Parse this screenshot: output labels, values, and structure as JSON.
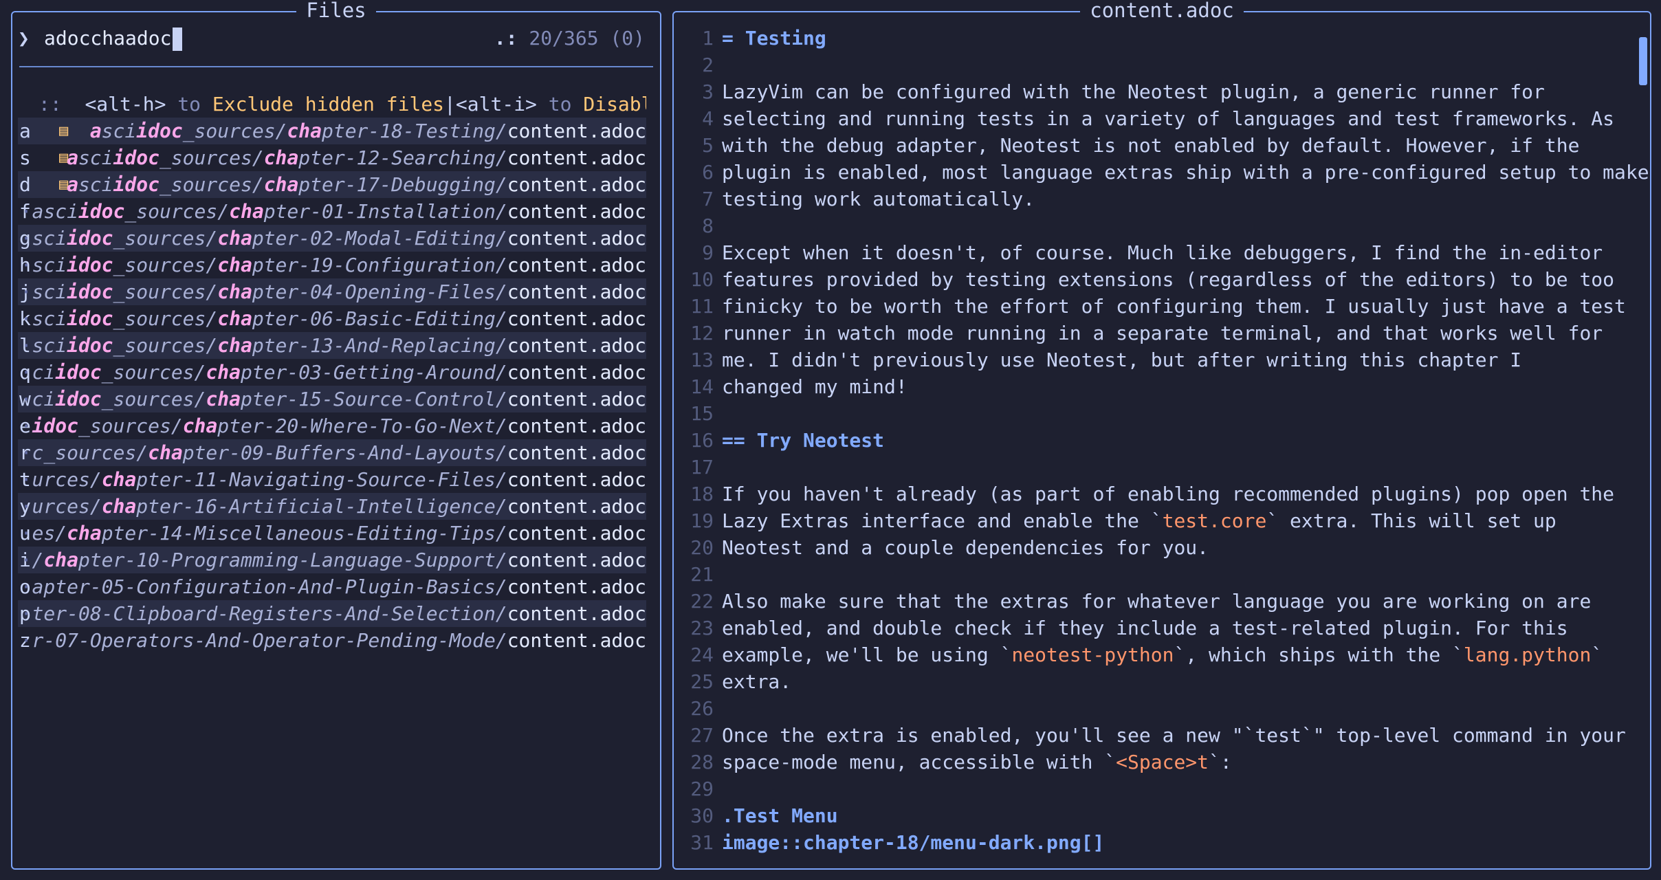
{
  "files_panel": {
    "title": "Files",
    "prompt": {
      "chevron": "❯",
      "query": "adocchaadoc",
      "count_prefix": ".:",
      "count": "20/365 (0)"
    },
    "hint": {
      "sep": "::",
      "key1": "<alt-h>",
      "to1": "to",
      "desc1": "Exclude hidden files",
      "bar": "|",
      "key2": "<alt-i>",
      "to2": "to",
      "desc2": "Disable··"
    },
    "rows": [
      {
        "key": "a",
        "trail": "",
        "icon": "▤",
        "hl": "a",
        "dir_pre": "sci",
        "hl2": "idoc",
        "dir_mid": "_sources/",
        "hl3": "cha",
        "dir_post": "pter-18-Testing/",
        "file": "content.adoc"
      },
      {
        "key": "s",
        "trail": "",
        "icon": "▤",
        "hl": "a",
        "dir_pre": "sci",
        "hl2": "idoc",
        "dir_mid": "_sources/",
        "hl3": "cha",
        "dir_post": "pter-12-Searching/",
        "file": "content.adoc"
      },
      {
        "key": "d",
        "trail": "",
        "icon": "▤",
        "hl": "a",
        "dir_pre": "sci",
        "hl2": "idoc",
        "dir_mid": "_sources/",
        "hl3": "cha",
        "dir_post": "pter-17-Debugging/",
        "file": "content.adoc"
      },
      {
        "key": "f",
        "trail": "··",
        "icon": "",
        "hl": "",
        "dir_pre": "asci",
        "hl2": "idoc",
        "dir_mid": "_sources/",
        "hl3": "cha",
        "dir_post": "pter-01-Installation/",
        "file": "content.adoc"
      },
      {
        "key": "g",
        "trail": "··",
        "icon": "",
        "hl": "",
        "dir_pre": "sci",
        "hl2": "idoc",
        "dir_mid": "_sources/",
        "hl3": "cha",
        "dir_post": "pter-02-Modal-Editing/",
        "file": "content.adoc"
      },
      {
        "key": "h",
        "trail": "··",
        "icon": "",
        "hl": "",
        "dir_pre": "sci",
        "hl2": "idoc",
        "dir_mid": "_sources/",
        "hl3": "cha",
        "dir_post": "pter-19-Configuration/",
        "file": "content.adoc"
      },
      {
        "key": "j",
        "trail": "··",
        "icon": "",
        "hl": "",
        "dir_pre": "sci",
        "hl2": "idoc",
        "dir_mid": "_sources/",
        "hl3": "cha",
        "dir_post": "pter-04-Opening-Files/",
        "file": "content.adoc"
      },
      {
        "key": "k",
        "trail": "··",
        "icon": "",
        "hl": "",
        "dir_pre": "sci",
        "hl2": "idoc",
        "dir_mid": "_sources/",
        "hl3": "cha",
        "dir_post": "pter-06-Basic-Editing/",
        "file": "content.adoc"
      },
      {
        "key": "l",
        "trail": "··",
        "icon": "",
        "hl": "",
        "dir_pre": "sci",
        "hl2": "idoc",
        "dir_mid": "_sources/",
        "hl3": "cha",
        "dir_post": "pter-13-And-Replacing/",
        "file": "content.adoc"
      },
      {
        "key": "q",
        "trail": "··",
        "icon": "",
        "hl": "",
        "dir_pre": "ci",
        "hl2": "idoc",
        "dir_mid": "_sources/",
        "hl3": "cha",
        "dir_post": "pter-03-Getting-Around/",
        "file": "content.adoc"
      },
      {
        "key": "w",
        "trail": "··",
        "icon": "",
        "hl": "",
        "dir_pre": "ci",
        "hl2": "idoc",
        "dir_mid": "_sources/",
        "hl3": "cha",
        "dir_post": "pter-15-Source-Control/",
        "file": "content.adoc"
      },
      {
        "key": "e",
        "trail": "··",
        "icon": "",
        "hl": "",
        "dir_pre": "",
        "hl2": "idoc",
        "dir_mid": "_sources/",
        "hl3": "cha",
        "dir_post": "pter-20-Where-To-Go-Next/",
        "file": "content.adoc"
      },
      {
        "key": "r",
        "trail": "··",
        "icon": "",
        "hl": "",
        "dir_pre": "c",
        "hl2": "",
        "dir_mid": "_sources/",
        "hl3": "cha",
        "dir_post": "pter-09-Buffers-And-Layouts/",
        "file": "content.adoc"
      },
      {
        "key": "t",
        "trail": "··",
        "icon": "",
        "hl": "",
        "dir_pre": "urces/",
        "hl2": "",
        "dir_mid": "",
        "hl3": "cha",
        "dir_post": "pter-11-Navigating-Source-Files/",
        "file": "content.adoc"
      },
      {
        "key": "y",
        "trail": "··",
        "icon": "",
        "hl": "",
        "dir_pre": "urces/",
        "hl2": "",
        "dir_mid": "",
        "hl3": "cha",
        "dir_post": "pter-16-Artificial-Intelligence/",
        "file": "content.adoc"
      },
      {
        "key": "u",
        "trail": "··",
        "icon": "",
        "hl": "",
        "dir_pre": "es/",
        "hl2": "",
        "dir_mid": "",
        "hl3": "cha",
        "dir_post": "pter-14-Miscellaneous-Editing-Tips/",
        "file": "content.adoc"
      },
      {
        "key": "i",
        "trail": "··",
        "icon": "",
        "hl": "",
        "dir_pre": "/",
        "hl2": "",
        "dir_mid": "",
        "hl3": "cha",
        "dir_post": "pter-10-Programming-Language-Support/",
        "file": "content.adoc"
      },
      {
        "key": "o",
        "trail": "··",
        "icon": "",
        "hl": "",
        "dir_pre": "apter-05-Configuration-And-Plugin-Basics/",
        "hl2": "",
        "dir_mid": "",
        "hl3": "",
        "dir_post": "",
        "file": "content.adoc"
      },
      {
        "key": "p",
        "trail": "··",
        "icon": "",
        "hl": "",
        "dir_pre": "ter-08-Clipboard-Registers-And-Selection/",
        "hl2": "",
        "dir_mid": "",
        "hl3": "",
        "dir_post": "",
        "file": "content.adoc"
      },
      {
        "key": "z",
        "trail": "··",
        "icon": "",
        "hl": "",
        "dir_pre": "r-07-Operators-And-Operator-Pending-Mode/",
        "hl2": "",
        "dir_mid": "",
        "hl3": "",
        "dir_post": "",
        "file": "content.adoc"
      }
    ]
  },
  "preview_panel": {
    "title": "content.adoc",
    "lines": [
      {
        "n": "1",
        "parts": [
          {
            "t": "= Testing",
            "c": "h1"
          }
        ]
      },
      {
        "n": "2",
        "parts": []
      },
      {
        "n": "3",
        "parts": [
          {
            "t": "LazyVim can be configured with the Neotest plugin, a generic runner for",
            "c": ""
          }
        ]
      },
      {
        "n": "4",
        "parts": [
          {
            "t": "selecting and running tests in a variety of languages and test frameworks. As",
            "c": ""
          }
        ]
      },
      {
        "n": "5",
        "parts": [
          {
            "t": "with the debug adapter, Neotest is not enabled by default. However, if the",
            "c": ""
          }
        ]
      },
      {
        "n": "6",
        "parts": [
          {
            "t": "plugin is enabled, most language extras ship with a pre-configured setup to make",
            "c": ""
          }
        ]
      },
      {
        "n": "7",
        "parts": [
          {
            "t": "testing work automatically.",
            "c": ""
          }
        ]
      },
      {
        "n": "8",
        "parts": []
      },
      {
        "n": "9",
        "parts": [
          {
            "t": "Except when it doesn't, of course. Much like debuggers, I find the in-editor",
            "c": ""
          }
        ]
      },
      {
        "n": "10",
        "parts": [
          {
            "t": "features provided by testing extensions (regardless of the editors) to be too",
            "c": ""
          }
        ]
      },
      {
        "n": "11",
        "parts": [
          {
            "t": "finicky to be worth the effort of configuring them. I usually just have a test",
            "c": ""
          }
        ]
      },
      {
        "n": "12",
        "parts": [
          {
            "t": "runner in watch mode running in a separate terminal, and that works well for",
            "c": ""
          }
        ]
      },
      {
        "n": "13",
        "parts": [
          {
            "t": "me. I didn't previously use Neotest, but after writing this chapter I",
            "c": ""
          }
        ]
      },
      {
        "n": "14",
        "parts": [
          {
            "t": "changed my mind!",
            "c": ""
          }
        ]
      },
      {
        "n": "15",
        "parts": []
      },
      {
        "n": "16",
        "parts": [
          {
            "t": "== Try Neotest",
            "c": "h1"
          }
        ]
      },
      {
        "n": "17",
        "parts": []
      },
      {
        "n": "18",
        "parts": [
          {
            "t": "If you haven't already (as part of enabling recommended plugins) pop open the",
            "c": ""
          }
        ]
      },
      {
        "n": "19",
        "parts": [
          {
            "t": "Lazy Extras interface and enable the `",
            "c": ""
          },
          {
            "t": "test.core",
            "c": "mono"
          },
          {
            "t": "` extra. This will set up",
            "c": ""
          }
        ]
      },
      {
        "n": "20",
        "parts": [
          {
            "t": "Neotest and a couple dependencies for you.",
            "c": ""
          }
        ]
      },
      {
        "n": "21",
        "parts": []
      },
      {
        "n": "22",
        "parts": [
          {
            "t": "Also make sure that the extras for whatever language you are working on are",
            "c": ""
          }
        ]
      },
      {
        "n": "23",
        "parts": [
          {
            "t": "enabled, and double check if they include a test-related plugin. For this",
            "c": ""
          }
        ]
      },
      {
        "n": "24",
        "parts": [
          {
            "t": "example, we'll be using `",
            "c": ""
          },
          {
            "t": "neotest-python",
            "c": "mono"
          },
          {
            "t": "`, which ships with the `",
            "c": ""
          },
          {
            "t": "lang.python",
            "c": "mono"
          },
          {
            "t": "`",
            "c": ""
          }
        ]
      },
      {
        "n": "25",
        "parts": [
          {
            "t": "extra.",
            "c": ""
          }
        ]
      },
      {
        "n": "26",
        "parts": []
      },
      {
        "n": "27",
        "parts": [
          {
            "t": "Once the extra is enabled, you'll see a new \"`test`\" top-level command in your",
            "c": ""
          }
        ]
      },
      {
        "n": "28",
        "parts": [
          {
            "t": "space-mode menu, accessible with `",
            "c": ""
          },
          {
            "t": "<Space>t",
            "c": "mono"
          },
          {
            "t": "`:",
            "c": ""
          }
        ]
      },
      {
        "n": "29",
        "parts": []
      },
      {
        "n": "30",
        "parts": [
          {
            "t": ".Test Menu",
            "c": "h1"
          }
        ]
      },
      {
        "n": "31",
        "parts": [
          {
            "t": "image::chapter-18/menu-dark.png[]",
            "c": "h1"
          }
        ]
      }
    ]
  }
}
